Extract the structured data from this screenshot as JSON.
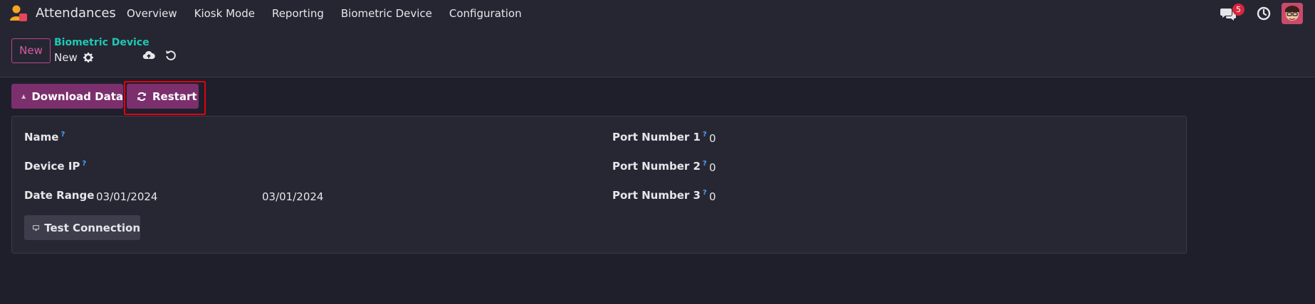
{
  "navbar": {
    "app_title": "Attendances",
    "menu": [
      "Overview",
      "Kiosk Mode",
      "Reporting",
      "Biometric Device",
      "Configuration"
    ],
    "chat_count": "5"
  },
  "control_panel": {
    "new_label": "New",
    "breadcrumb_parent": "Biometric Device",
    "breadcrumb_current": "New"
  },
  "actions": {
    "download_label": "Download Data",
    "restart_label": "Restart"
  },
  "form": {
    "name_label": "Name",
    "device_ip_label": "Device IP",
    "date_range_label": "Date Range",
    "date_from": "03/01/2024",
    "date_to": "03/01/2024",
    "help_mark": "?",
    "port1_label": "Port Number 1",
    "port1_value": "0",
    "port2_label": "Port Number 2",
    "port2_value": "0",
    "port3_label": "Port Number 3",
    "port3_value": "0",
    "test_connection_label": "Test Connection"
  },
  "colors": {
    "accent_purple": "#7b2f6d",
    "breadcrumb_teal": "#1fc8b4",
    "highlight_red": "#e0000f",
    "badge_red": "#d7263d"
  }
}
